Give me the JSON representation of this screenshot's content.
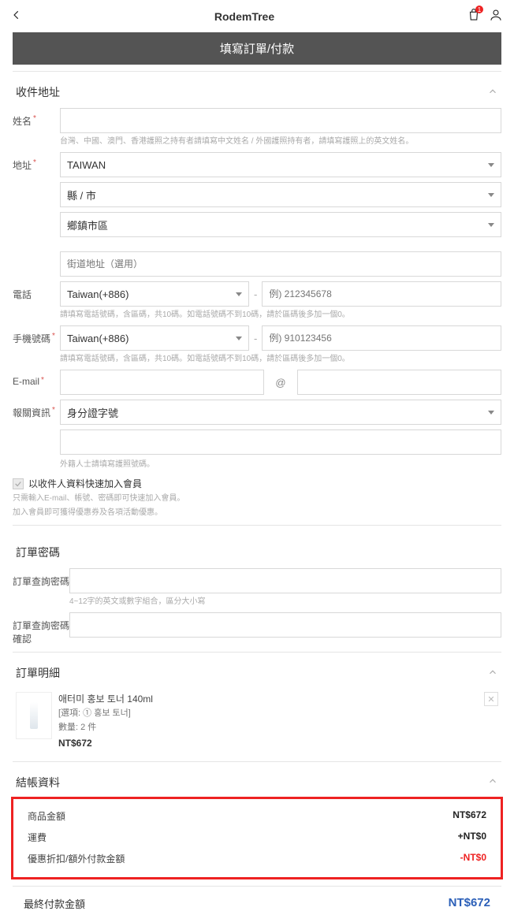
{
  "header": {
    "title": "RodemTree",
    "cart_badge": "1"
  },
  "page_title": "填寫訂單/付款",
  "address_section": {
    "title": "收件地址",
    "name_label": "姓名",
    "name_help": "台灣、中國、澳門、香港護照之持有者請填寫中文姓名 / 外國護照持有者，請填寫護照上的英文姓名。",
    "addr_label": "地址",
    "country": "TAIWAN",
    "county_ph": "縣 / 市",
    "district_ph": "鄉鎮市區",
    "street_ph": "街道地址（選用）",
    "tel_label": "電話",
    "tel_code": "Taiwan(+886)",
    "tel_ph": "例) 212345678",
    "tel_help": "請填寫電話號碼，含區碼，共10碼。如電話號碼不到10碼，請於區碼後多加一個0。",
    "mobile_label": "手機號碼",
    "mobile_code": "Taiwan(+886)",
    "mobile_ph": "例) 910123456",
    "mobile_help": "請填寫電話號碼，含區碼，共10碼。如電話號碼不到10碼，請於區碼後多加一個0。",
    "email_label": "E-mail",
    "customs_label": "報關資訊",
    "customs_sel": "身分證字號",
    "customs_help": "外籍人士請填寫護照號碼。",
    "join_label": "以收件人資料快速加入會員",
    "join_help1": "只需輸入E-mail、帳號、密碼即可快速加入會員。",
    "join_help2": "加入會員即可獲得優惠券及各項活動優惠。"
  },
  "pw_section": {
    "title": "訂單密碼",
    "pw_label": "訂單查詢密碼",
    "pw_help": "4~12字的英文或數字組合，區分大小寫",
    "pw2_label": "訂單查詢密碼確認"
  },
  "order_section": {
    "title": "訂單明細",
    "item": {
      "name": "애터미 홍보 토너 140ml",
      "option": "[選項: ① 홍보 토너]",
      "qty": "數量: 2 件",
      "price": "NT$672"
    }
  },
  "billing": {
    "title": "結帳資料",
    "subtotal_label": "商品金額",
    "subtotal_val": "NT$672",
    "ship_label": "運費",
    "ship_val": "+NT$0",
    "disc_label": "優惠折扣/額外付款金額",
    "disc_val": "-NT$0",
    "total_label": "最終付款金額",
    "total_val": "NT$672"
  }
}
